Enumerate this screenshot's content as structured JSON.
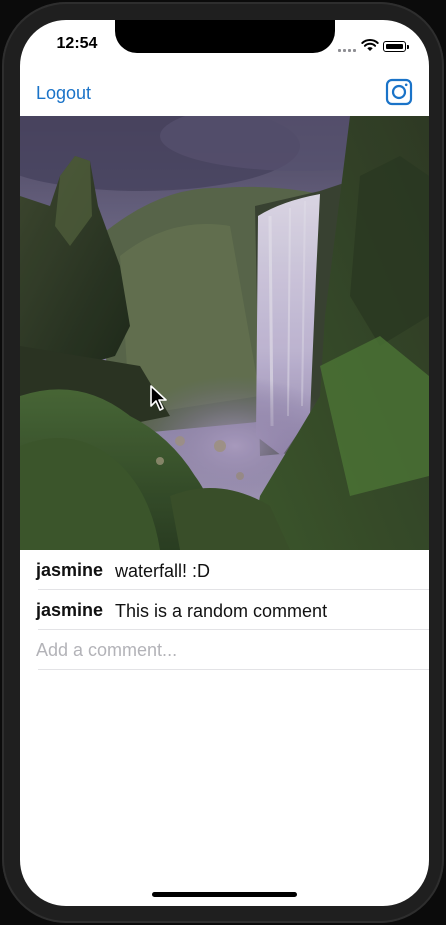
{
  "status_bar": {
    "time": "12:54"
  },
  "navbar": {
    "logout_label": "Logout",
    "right_icon": "instagram-camera-icon",
    "accent_color": "#1a73c8"
  },
  "post": {
    "image_description_icon": "waterfall-photo"
  },
  "comments": [
    {
      "user": "jasmine",
      "text": "waterfall! :D"
    },
    {
      "user": "jasmine",
      "text": "This is a random comment"
    }
  ],
  "comment_input": {
    "placeholder": "Add a comment...",
    "value": ""
  }
}
